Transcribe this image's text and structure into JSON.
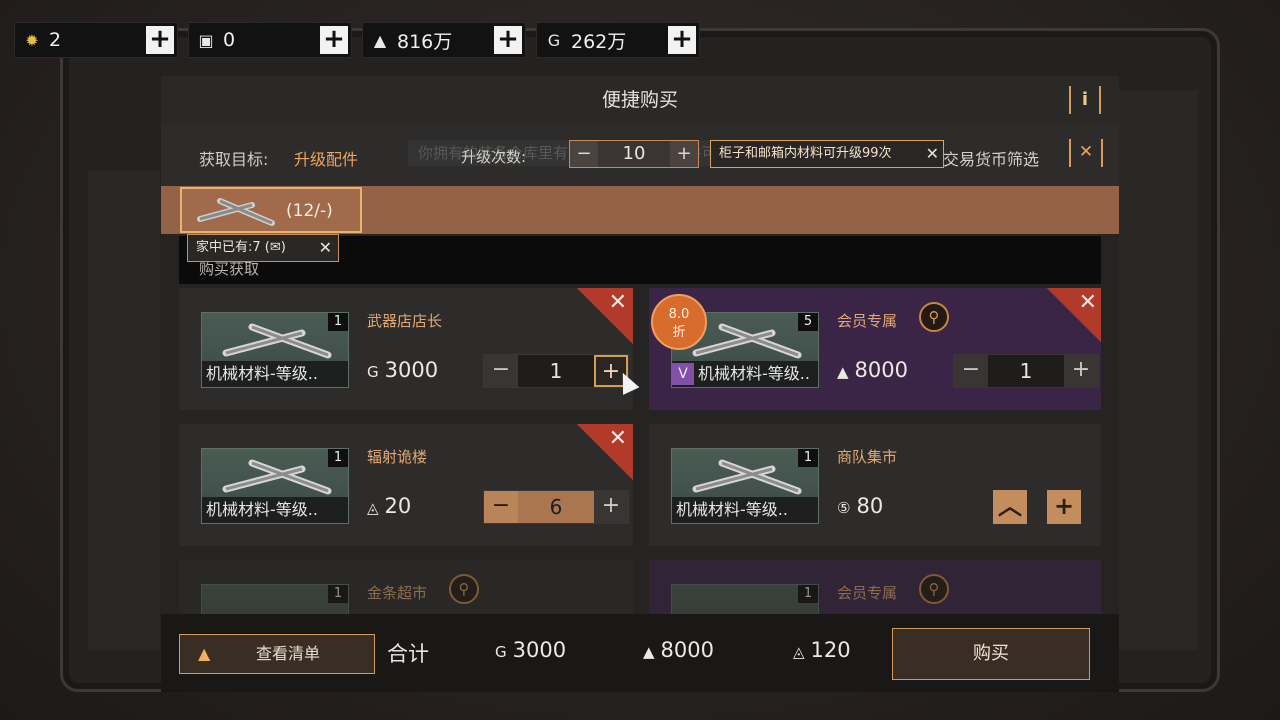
{
  "topbar": {
    "currencies": [
      {
        "icon": "gear-coin-icon",
        "glyph": "✹",
        "value": "2"
      },
      {
        "icon": "ticket-icon",
        "glyph": "▣",
        "value": "0"
      },
      {
        "icon": "gold-bar-icon",
        "glyph": "▲",
        "value": "816万"
      },
      {
        "icon": "coin-icon",
        "glyph": "G",
        "value": "262万"
      }
    ],
    "plus_glyph": "+"
  },
  "dialog": {
    "title": "便捷购买",
    "info_glyph": "i"
  },
  "filter": {
    "target_label": "获取目标:",
    "target_value": "升级配件",
    "ghost_text": "你拥有的装备仓库里有120件可升级的配件可…",
    "upgrade_label": "升级次数:",
    "upgrade_value": "10",
    "tip": "柜子和邮箱内材料可升级99次",
    "currency_filter_label": "交易货币筛选",
    "tool_glyph": "✕"
  },
  "material": {
    "count": "(12/-)",
    "have_tip": "家中已有:7 (✉)"
  },
  "section_header": "购买获取",
  "offers": [
    {
      "shop": "武器店店长",
      "item_name": "机械材料-等级..",
      "qty": "1",
      "price_icon": "G",
      "price": "3000",
      "amount": "1"
    },
    {
      "shop": "会员专属",
      "item_name": "机械材料-等级..",
      "qty": "5",
      "price_icon": "▲",
      "price": "8000",
      "amount": "1",
      "discount": "8.0\n折"
    },
    {
      "shop": "辐射诡楼",
      "item_name": "机械材料-等级..",
      "qty": "1",
      "price_icon": "◬",
      "price": "20",
      "amount": "6"
    },
    {
      "shop": "商队集市",
      "item_name": "机械材料-等级..",
      "qty": "1",
      "price_icon": "⑤",
      "price": "80"
    },
    {
      "shop": "金条超市",
      "qty": "1"
    },
    {
      "shop": "会员专属",
      "qty": "1"
    }
  ],
  "bottom": {
    "list_button": "查看清单",
    "total_label": "合计",
    "totals": [
      {
        "icon": "G",
        "value": "3000"
      },
      {
        "icon": "▲",
        "value": "8000"
      },
      {
        "icon": "◬",
        "value": "120"
      }
    ],
    "buy_button": "购买"
  },
  "colors": {
    "accent": "#d29a5c",
    "material_bar": "#946247",
    "member_card": "#3b2547",
    "remove_corner": "#b13a2a"
  }
}
